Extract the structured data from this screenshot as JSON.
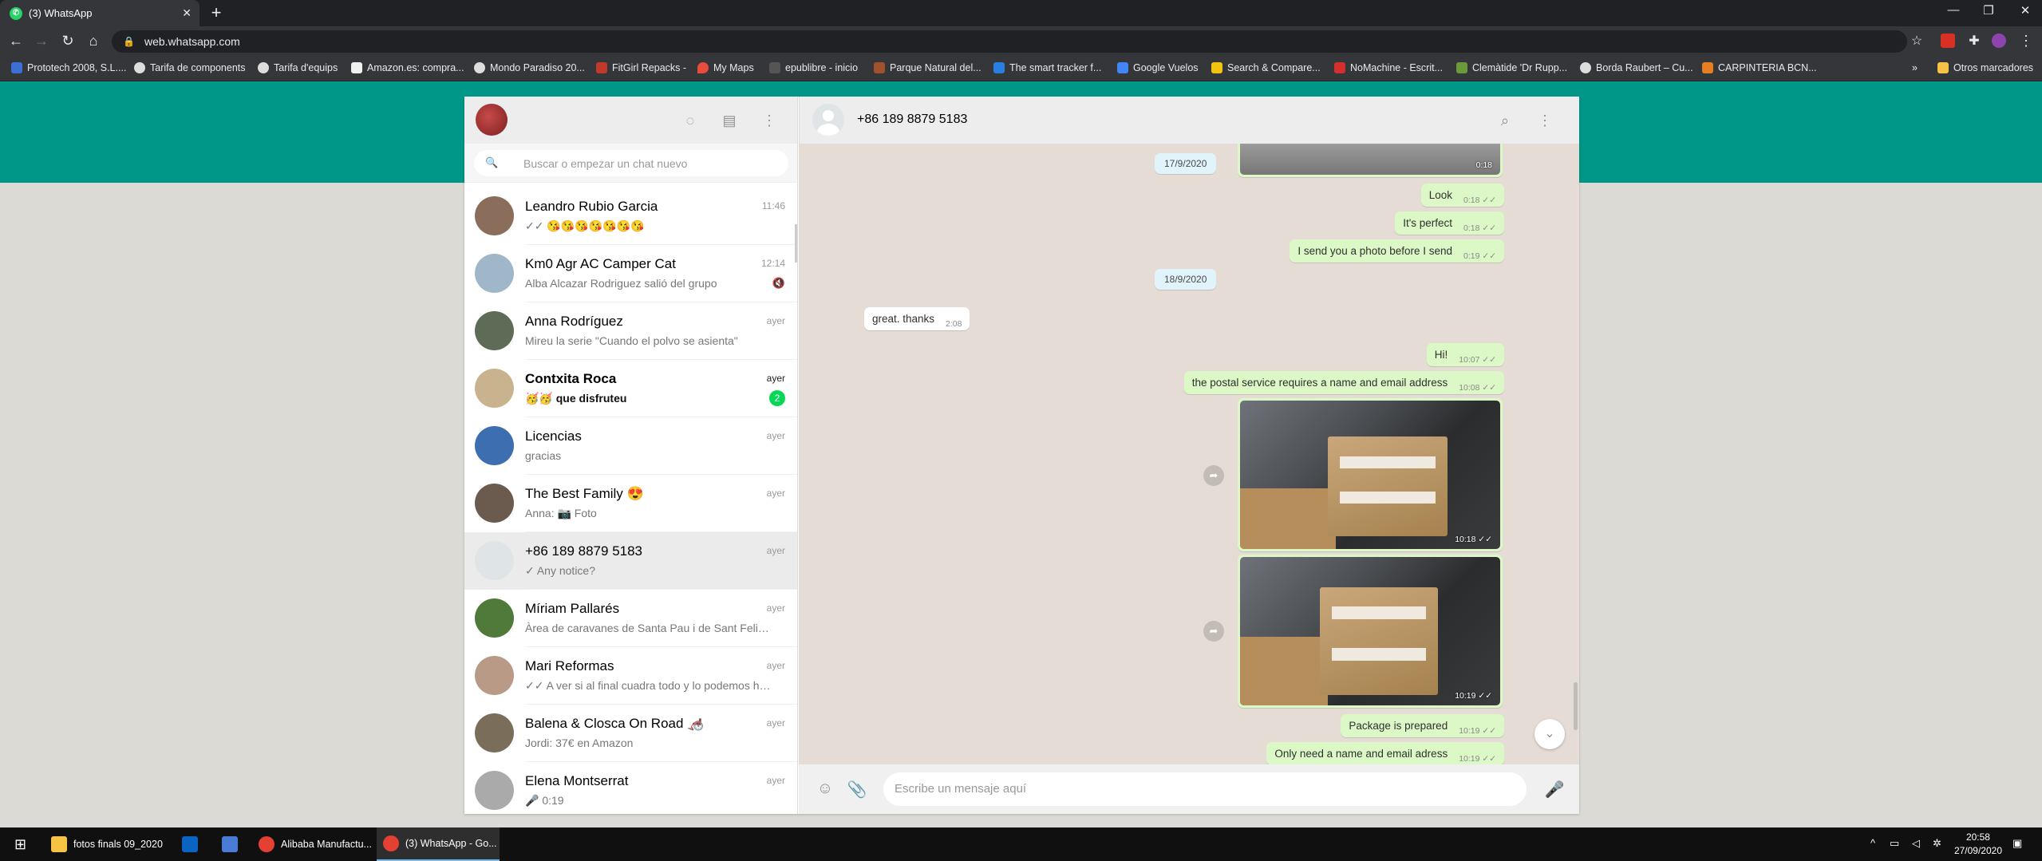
{
  "browser": {
    "tab_title": "(3) WhatsApp",
    "url": "web.whatsapp.com",
    "bookmarks": [
      "Prototech 2008, S.L....",
      "Tarifa de components",
      "Tarifa d'equips",
      "Amazon.es: compra...",
      "Mondo Paradiso 20...",
      "FitGirl Repacks -",
      "My Maps",
      "epublibre - inicio",
      "Parque Natural del...",
      "The smart tracker f...",
      "Google Vuelos",
      "Search & Compare...",
      "NoMachine - Escrit...",
      "Clemàtide 'Dr Rupp...",
      "Borda Raubert – Cu...",
      "CARPINTERIA BCN..."
    ],
    "other_bookmarks": "Otros marcadores"
  },
  "sidebar": {
    "search_placeholder": "Buscar o empezar un chat nuevo",
    "chats": [
      {
        "name": "Leandro Rubio Garcia",
        "time": "11:46",
        "preview": "✓✓ 😘😘😘😘😘😘😘",
        "avatar_color": "#8a6d5a"
      },
      {
        "name": "Km0 Agr AC Camper Cat",
        "time": "12:14",
        "preview": "Alba Alcazar Rodriguez salió del grupo",
        "avatar_color": "#9fb7c9",
        "muted": true
      },
      {
        "name": "Anna Rodríguez",
        "time": "ayer",
        "preview": "Mireu la serie \"Cuando el polvo se asienta\"",
        "avatar_color": "#5d6b57"
      },
      {
        "name": "Contxita Roca",
        "time": "ayer",
        "preview": "🥳🥳 que disfruteu",
        "avatar_color": "#c9b38f",
        "unread": "2",
        "bold": true
      },
      {
        "name": "Licencias",
        "time": "ayer",
        "preview": "gracias",
        "avatar_color": "#3d6fb0"
      },
      {
        "name": "The Best Family 😍",
        "time": "ayer",
        "preview": "Anna: 📷 Foto",
        "avatar_color": "#6b5a4e"
      },
      {
        "name": "+86 189 8879 5183",
        "time": "ayer",
        "preview": "✓ Any notice?",
        "avatar_color": "#dfe5e7",
        "active": true
      },
      {
        "name": "Míriam Pallarés",
        "time": "ayer",
        "preview": "Àrea de caravanes de Santa Pau i de Sant Feliu d...",
        "avatar_color": "#4f7a3a"
      },
      {
        "name": "Mari Reformas",
        "time": "ayer",
        "preview": "✓✓ A ver si al final cuadra todo y lo podemos hacer",
        "avatar_color": "#b89a86"
      },
      {
        "name": "Balena & Closca On Road 🦽",
        "time": "ayer",
        "preview": "Jordi: 37€ en Amazon",
        "avatar_color": "#7a6e5a"
      },
      {
        "name": "Elena Montserrat",
        "time": "ayer",
        "preview": "🎤 0:19",
        "avatar_color": "#aaa"
      }
    ]
  },
  "conversation": {
    "title": "+86 189 8879 5183",
    "input_placeholder": "Escribe un mensaje aquí",
    "top_photo_time": "0:18",
    "date_1": "17/9/2020",
    "date_2": "18/9/2020",
    "messages": [
      {
        "text": "Look",
        "time": "0:18 ✓✓"
      },
      {
        "text": "It's perfect",
        "time": "0:18 ✓✓"
      },
      {
        "text": "I send you a photo before I send",
        "time": "0:19 ✓✓"
      },
      {
        "text": "great.  thanks",
        "time": "2:08"
      },
      {
        "text": "Hi!",
        "time": "10:07 ✓✓"
      },
      {
        "text": "the postal service requires a name and email address",
        "time": "10:08 ✓✓"
      },
      {
        "text": "Package is prepared",
        "time": "10:19 ✓✓"
      },
      {
        "text": "Only need a name and email adress",
        "time": "10:19 ✓✓"
      }
    ],
    "photo_1_time": "10:18 ✓✓",
    "photo_2_time": "10:19 ✓✓"
  },
  "taskbar": {
    "items": [
      "fotos finals 09_2020",
      "Alibaba Manufactu...",
      "(3) WhatsApp - Go..."
    ],
    "time": "20:58",
    "date": "27/09/2020"
  },
  "colors": {
    "whatsapp_green": "#009688",
    "outgoing_bubble": "#dcf8c6",
    "unread_badge": "#06d755"
  }
}
